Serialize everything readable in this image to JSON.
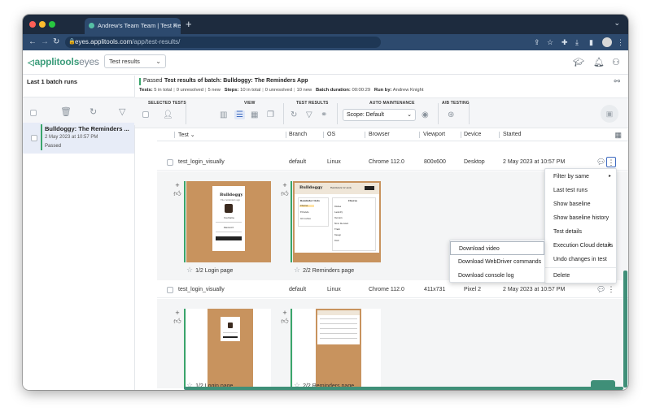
{
  "browser": {
    "tab_title": "Andrew's Team Team | Test Re...",
    "tab_close": "×",
    "new_tab": "+",
    "url_host": "eyes.applitools.com",
    "url_path": "/app/test-results/"
  },
  "header": {
    "logo_main": "applitools",
    "logo_suffix": "eyes",
    "app_select": "Test results"
  },
  "left_panel": {
    "title": "Last 1 batch runs",
    "batch": {
      "name": "Bulldoggy: The Reminders ...",
      "date": "2 May 2023 at 10:57 PM",
      "status": "Passed"
    }
  },
  "batch_summary": {
    "status": "Passed",
    "title": "Test results of batch:  Bulldoggy: The Reminders App",
    "tests_label": "Tests:",
    "tests_value": "5 in total",
    "unresolved_1": "0 unresolved",
    "new_1": "5 new",
    "steps_label": "Steps:",
    "steps_value": "10 in total",
    "unresolved_2": "0 unresolved",
    "new_2": "10 new",
    "duration_label": "Batch duration:",
    "duration_value": "00:00:29",
    "runby_label": "Run by:",
    "runby_value": "Andrew Knight"
  },
  "toolbar": {
    "selected_tests": "SELECTED TESTS",
    "view": "VIEW",
    "test_results": "TEST RESULTS",
    "auto_maintenance": "AUTO MAINTENANCE",
    "ab_testing": "A/B TESTING",
    "scope": "Scope: Default"
  },
  "columns": {
    "test": "Test",
    "branch": "Branch",
    "os": "OS",
    "browser": "Browser",
    "viewport": "Viewport",
    "device": "Device",
    "started": "Started"
  },
  "rows": [
    {
      "test": "test_login_visually",
      "branch": "default",
      "os": "Linux",
      "browser": "Chrome 112.0",
      "viewport": "800x600",
      "device": "Desktop",
      "started": "2 May 2023 at 10:57 PM",
      "steps": [
        "1/2 Login page",
        "2/2 Reminders page"
      ]
    },
    {
      "test": "test_login_visually",
      "branch": "default",
      "os": "Linux",
      "browser": "Chrome 112.0",
      "viewport": "411x731",
      "device": "Pixel 2",
      "started": "2 May 2023 at 10:57 PM",
      "steps": [
        "1/2 Login page",
        "2/2 Reminders page"
      ]
    }
  ],
  "thumbnail_text": {
    "brand": "Bulldoggy",
    "subtitle": "The reminders app",
    "username": "Username",
    "password": "Password",
    "login": "Login",
    "reminders_header": "Reminders for andy",
    "logout": "Logout",
    "reminder_lists": "Reminder Lists",
    "chores": "Chores",
    "list_items": [
      "Chores",
      "Errands",
      "Groceries"
    ],
    "chore_items": [
      "Dishes",
      "Laundry",
      "Vacuum",
      "Mow the lawn",
      "Trash",
      "Sweep",
      "Dust"
    ]
  },
  "context_menu": {
    "items": [
      {
        "label": "Filter by same",
        "arrow": "▸"
      },
      {
        "label": "Last test runs"
      },
      {
        "label": "Show baseline"
      },
      {
        "label": "Show baseline history"
      },
      {
        "label": "Test details"
      },
      {
        "label": "Execution Cloud details",
        "arrow": "▸"
      },
      {
        "label": "Undo changes in test"
      },
      {
        "label": "Delete"
      }
    ],
    "submenu": [
      "Download video",
      "Download WebDriver commands",
      "Download console log"
    ]
  },
  "colors": {
    "brand": "#3d9d7b",
    "passed": "#3aa56b",
    "browser_chrome": "#2d4a6e",
    "thumbnail_bg": "#c8935e"
  }
}
